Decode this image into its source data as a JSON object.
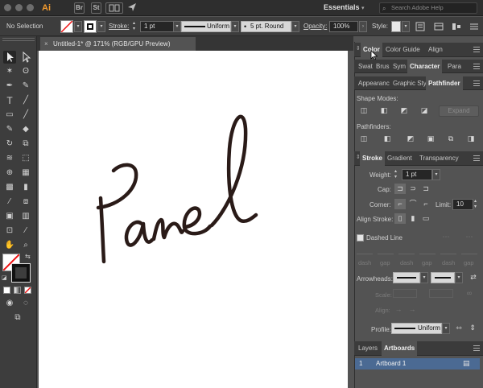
{
  "app": {
    "logo": "Ai",
    "workspace": "Essentials",
    "search_placeholder": "Search Adobe Help",
    "bridge": "Br",
    "stock": "St"
  },
  "control": {
    "selection": "No Selection",
    "stroke_label": "Stroke:",
    "stroke_weight": "1 pt",
    "profile": "Uniform",
    "brush": "5 pt. Round",
    "opacity_label": "Opacity:",
    "opacity": "100%",
    "style_label": "Style:"
  },
  "document": {
    "tab_title": "Untitled-1* @ 171% (RGB/GPU Preview)"
  },
  "canvas_art": {
    "text": "Panel",
    "stroke_color": "#2a1b18"
  },
  "panels": {
    "top_tabs": [
      "Color",
      "Color Guide",
      "Align"
    ],
    "second_tabs": [
      "Swat",
      "Brus",
      "Sym",
      "Character",
      "Para"
    ],
    "third_tabs": [
      "Appearanc",
      "Graphic Sty",
      "Pathfinder"
    ],
    "shape_modes_label": "Shape Modes:",
    "expand_label": "Expand",
    "pathfinders_label": "Pathfinders:",
    "stroke_tabs": [
      "Stroke",
      "Gradient",
      "Transparency"
    ],
    "weight_label": "Weight:",
    "weight_value": "1 pt",
    "cap_label": "Cap:",
    "corner_label": "Corner:",
    "limit_label": "Limit:",
    "limit_value": "10",
    "align_stroke_label": "Align Stroke:",
    "dashed_line_label": "Dashed Line",
    "dash_labels": [
      "dash",
      "gap",
      "dash",
      "gap",
      "dash",
      "gap"
    ],
    "arrowheads_label": "Arrowheads:",
    "scale_label": "Scale:",
    "align_label": "Align:",
    "profile_label": "Profile:",
    "profile_value": "Uniform",
    "layers_tabs": [
      "Layers",
      "Artboards"
    ],
    "artboard_index": "1",
    "artboard_name": "Artboard 1"
  }
}
